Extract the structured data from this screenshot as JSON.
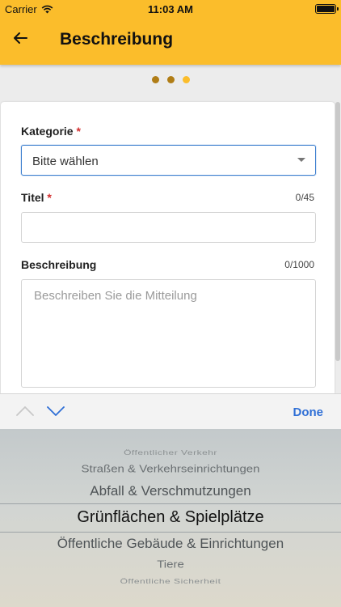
{
  "status_bar": {
    "carrier": "Carrier",
    "time": "11:03 AM"
  },
  "header": {
    "title": "Beschreibung",
    "back_icon": "arrow-left-icon"
  },
  "stepper": {
    "total_steps": 3,
    "current_step": 3,
    "colors": {
      "done": "#b07d16",
      "current": "#fbbd2b"
    }
  },
  "form": {
    "category": {
      "label": "Kategorie",
      "required_mark": "*",
      "value": "Bitte wählen"
    },
    "title": {
      "label": "Titel",
      "required_mark": "*",
      "counter": "0/45",
      "value": ""
    },
    "description": {
      "label": "Beschreibung",
      "counter": "0/1000",
      "placeholder": "Beschreiben Sie die Mitteilung"
    }
  },
  "toolbar": {
    "done_label": "Done",
    "accent": "#2f6fd6"
  },
  "picker": {
    "options": [
      "Öffentlicher Verkehr",
      "Straßen & Verkehrseinrichtungen",
      "Abfall & Verschmutzungen",
      "Grünflächen & Spielplätze",
      "Öffentliche Gebäude & Einrichtungen",
      "Tiere",
      "Öffentliche Sicherheit"
    ],
    "selected": "Grünflächen & Spielplätze"
  },
  "colors": {
    "header": "#fbbd2b",
    "required": "#d32f2f",
    "focus": "#3d7fcf"
  }
}
